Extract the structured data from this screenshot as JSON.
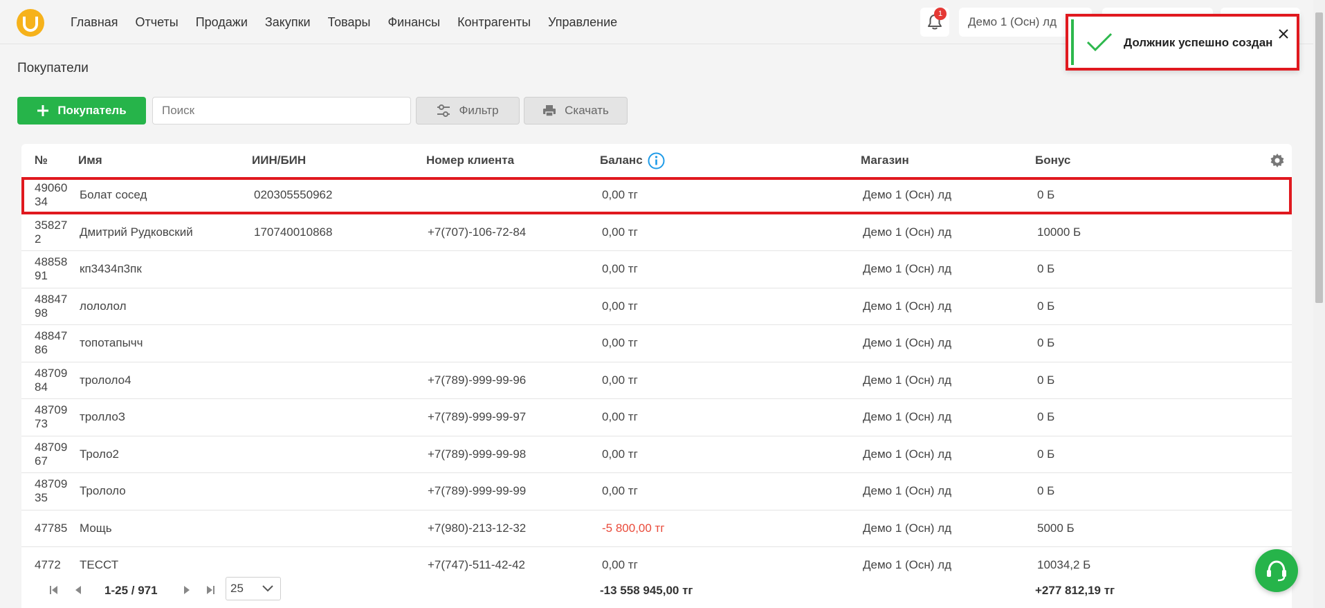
{
  "header": {
    "logo_letter": "U",
    "nav": [
      "Главная",
      "Отчеты",
      "Продажи",
      "Закупки",
      "Товары",
      "Финансы",
      "Контрагенты",
      "Управление"
    ],
    "notifications_count": "1",
    "store_selector": "Демо 1 (Осн) лд"
  },
  "toast": {
    "message": "Должник успешно создан"
  },
  "page": {
    "title": "Покупатели",
    "add_button": "Покупатель",
    "search_placeholder": "Поиск",
    "filter_button": "Фильтр",
    "download_button": "Скачать"
  },
  "table": {
    "columns": {
      "num": "№",
      "name": "Имя",
      "iin": "ИИН/БИН",
      "phone": "Номер клиента",
      "balance": "Баланс",
      "store": "Магазин",
      "bonus": "Бонус"
    },
    "rows": [
      {
        "id": "4906034",
        "name": "Болат сосед",
        "iin": "020305550962",
        "phone": "",
        "balance": "0,00 тг",
        "store": "Демо 1 (Осн) лд",
        "bonus": "0 Б",
        "highlighted": true
      },
      {
        "id": "358272",
        "name": "Дмитрий Рудковский",
        "iin": "170740010868",
        "phone": "+7(707)-106-72-84",
        "balance": "0,00 тг",
        "store": "Демо 1 (Осн) лд",
        "bonus": "10000 Б"
      },
      {
        "id": "4885891",
        "name": "кп3434п3пк",
        "iin": "",
        "phone": "",
        "balance": "0,00 тг",
        "store": "Демо 1 (Осн) лд",
        "bonus": "0 Б"
      },
      {
        "id": "4884798",
        "name": "лололол",
        "iin": "",
        "phone": "",
        "balance": "0,00 тг",
        "store": "Демо 1 (Осн) лд",
        "bonus": "0 Б"
      },
      {
        "id": "4884786",
        "name": "топотапычч",
        "iin": "",
        "phone": "",
        "balance": "0,00 тг",
        "store": "Демо 1 (Осн) лд",
        "bonus": "0 Б"
      },
      {
        "id": "4870984",
        "name": "трололо4",
        "iin": "",
        "phone": "+7(789)-999-99-96",
        "balance": "0,00 тг",
        "store": "Демо 1 (Осн) лд",
        "bonus": "0 Б"
      },
      {
        "id": "4870973",
        "name": "троллоЗ",
        "iin": "",
        "phone": "+7(789)-999-99-97",
        "balance": "0,00 тг",
        "store": "Демо 1 (Осн) лд",
        "bonus": "0 Б"
      },
      {
        "id": "4870967",
        "name": "Троло2",
        "iin": "",
        "phone": "+7(789)-999-99-98",
        "balance": "0,00 тг",
        "store": "Демо 1 (Осн) лд",
        "bonus": "0 Б"
      },
      {
        "id": "4870935",
        "name": "Трололо",
        "iin": "",
        "phone": "+7(789)-999-99-99",
        "balance": "0,00 тг",
        "store": "Демо 1 (Осн) лд",
        "bonus": "0 Б"
      },
      {
        "id": "47785",
        "name": "Мощь",
        "iin": "",
        "phone": "+7(980)-213-12-32",
        "balance": "-5 800,00 тг",
        "store": "Демо 1 (Осн) лд",
        "bonus": "5000 Б",
        "negative": true
      },
      {
        "id": "4772",
        "name": "ТЕССТ",
        "iin": "",
        "phone": "+7(747)-511-42-42",
        "balance": "0,00 тг",
        "store": "Демо 1 (Осн) лд",
        "bonus": "10034,2 Б"
      }
    ]
  },
  "pagination": {
    "range": "1-25 / 971",
    "page_size": "25",
    "total_balance": "-13 558 945,00 тг",
    "total_bonus": "+277 812,19 тг"
  },
  "colors": {
    "accent_green": "#26b44a",
    "highlight_red": "#e0191f",
    "negative": "#e94a3a"
  }
}
